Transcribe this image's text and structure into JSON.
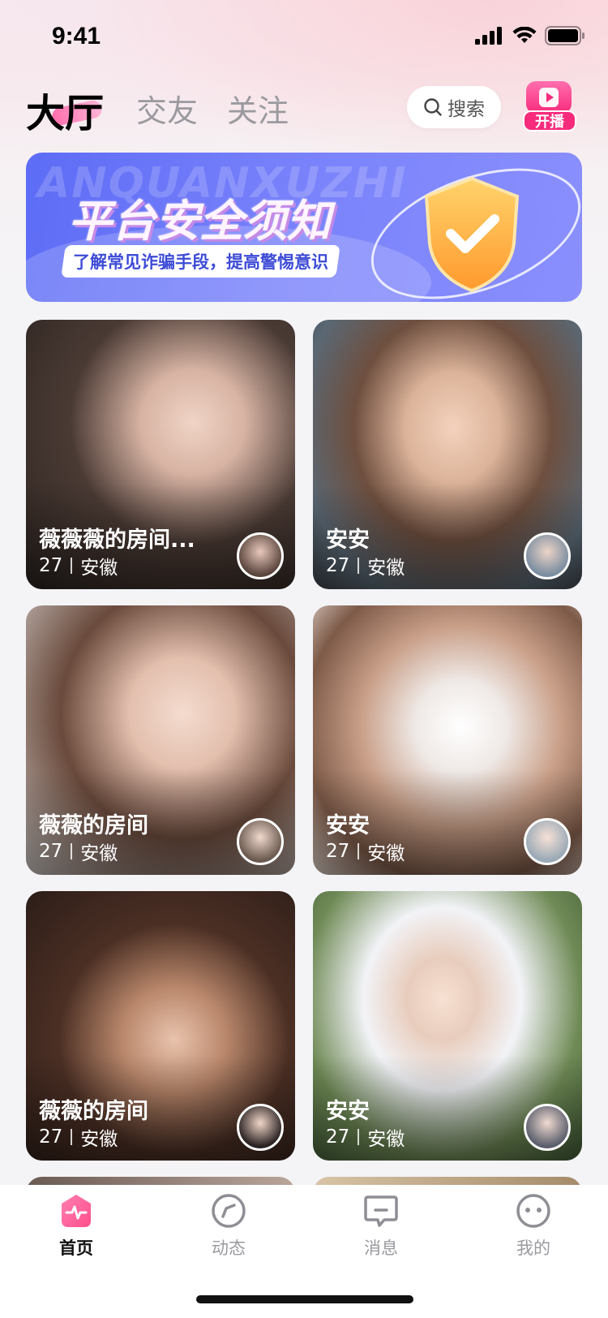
{
  "status_bar": {
    "time": "9:41"
  },
  "header": {
    "tabs": [
      {
        "label": "大厅",
        "active": true
      },
      {
        "label": "交友",
        "active": false
      },
      {
        "label": "关注",
        "active": false
      }
    ],
    "search_label": "搜索",
    "live_label": "开播"
  },
  "banner": {
    "watermark": "ANQUANXUZHI",
    "title": "平台安全须知",
    "subtitle": "了解常见诈骗手段，提高警惕意识"
  },
  "cards": [
    {
      "name": "薇薇薇的房间...",
      "age": "27",
      "location": "安徽"
    },
    {
      "name": "安安",
      "age": "27",
      "location": "安徽"
    },
    {
      "name": "薇薇的房间",
      "age": "27",
      "location": "安徽"
    },
    {
      "name": "安安",
      "age": "27",
      "location": "安徽"
    },
    {
      "name": "薇薇的房间",
      "age": "27",
      "location": "安徽"
    },
    {
      "name": "安安",
      "age": "27",
      "location": "安徽"
    }
  ],
  "bottom_nav": [
    {
      "label": "首页",
      "icon": "home-pulse-icon",
      "active": true
    },
    {
      "label": "动态",
      "icon": "compass-icon",
      "active": false
    },
    {
      "label": "消息",
      "icon": "message-icon",
      "active": false
    },
    {
      "label": "我的",
      "icon": "face-icon",
      "active": false
    }
  ],
  "colors": {
    "accent": "#f72b7c",
    "banner": "#6b77f8",
    "nav_active": "#ff5b96"
  }
}
